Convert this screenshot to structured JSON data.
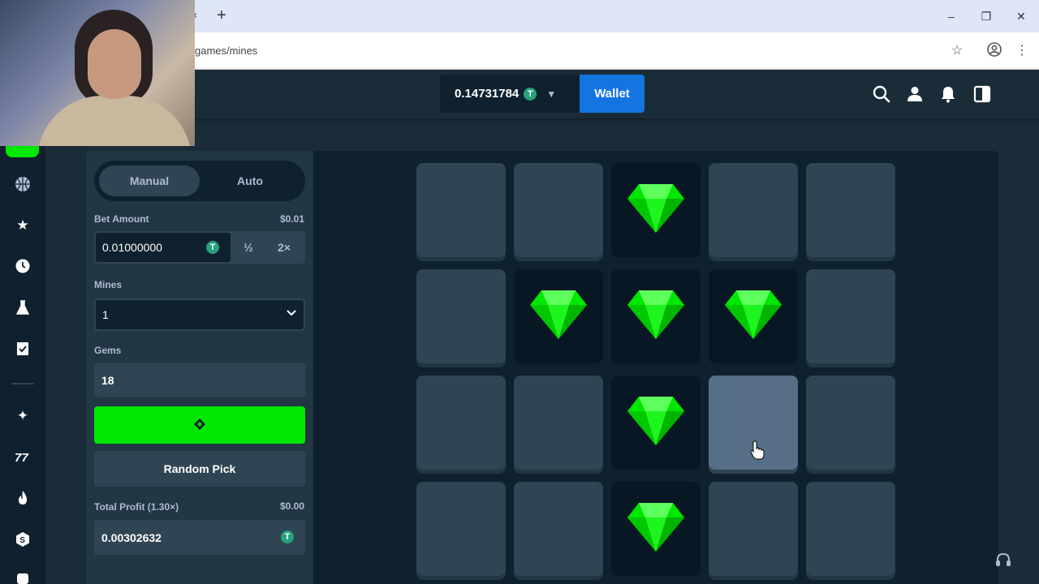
{
  "browser": {
    "url": "games/mines",
    "new_tab": "+",
    "tab_close": "×",
    "win_min": "–",
    "win_restore": "❐",
    "win_close": "✕"
  },
  "header": {
    "balance": "0.14731784",
    "currency_symbol": "T",
    "wallet_label": "Wallet"
  },
  "sidebar": {
    "manual_label": "Manual",
    "auto_label": "Auto",
    "bet_amount_label": "Bet Amount",
    "bet_amount_usd": "$0.01",
    "bet_amount_value": "0.01000000",
    "half_label": "½",
    "double_label": "2×",
    "mines_label": "Mines",
    "mines_value": "1",
    "gems_label": "Gems",
    "gems_value": "18",
    "random_pick_label": "Random Pick",
    "total_profit_label": "Total Profit (1.30×)",
    "total_profit_usd": "$0.00",
    "total_profit_value": "0.00302632"
  },
  "grid": {
    "rows": [
      [
        "closed",
        "closed",
        "gem",
        "closed",
        "closed"
      ],
      [
        "closed",
        "gem",
        "gem",
        "gem",
        "closed"
      ],
      [
        "closed",
        "closed",
        "gem",
        "hover",
        "closed"
      ],
      [
        "closed",
        "closed",
        "gem",
        "closed",
        "closed"
      ]
    ]
  },
  "colors": {
    "accent_green": "#00e701",
    "wallet_blue": "#1475e1",
    "tether_green": "#26a17b"
  }
}
